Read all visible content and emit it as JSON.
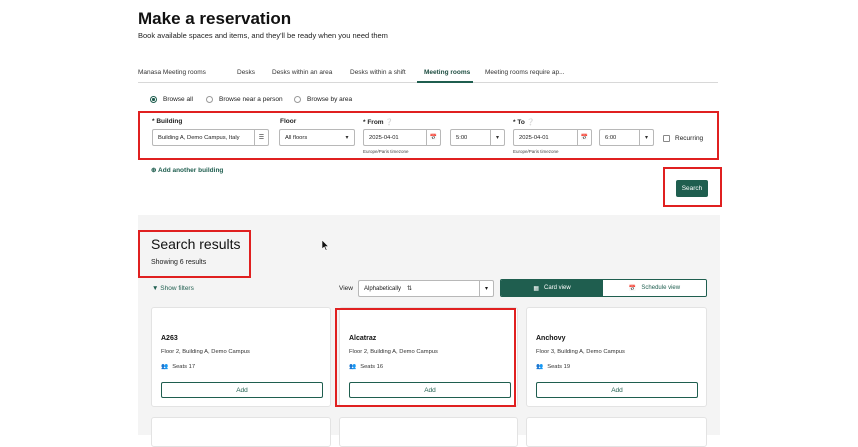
{
  "page": {
    "title": "Make a reservation",
    "subtitle": "Book available spaces and items, and they'll be ready when you need them"
  },
  "tabs": [
    {
      "label": "Manasa Meeting rooms"
    },
    {
      "label": "Desks"
    },
    {
      "label": "Desks within an area"
    },
    {
      "label": "Desks within a shift"
    },
    {
      "label": "Meeting rooms"
    },
    {
      "label": "Meeting rooms require ap..."
    }
  ],
  "active_tab": "Meeting rooms",
  "browse": {
    "options": [
      "Browse all",
      "Browse near a person",
      "Browse by area"
    ],
    "selected": "Browse all"
  },
  "filters": {
    "building_label": "* Building",
    "building_value": "Building A, Demo Campus, Italy",
    "floor_label": "Floor",
    "floor_value": "All floors",
    "from_label": "* From",
    "from_date": "2025-04-01",
    "from_time": "5:00",
    "from_tz": "Europe/Paris timezone",
    "to_label": "* To",
    "to_date": "2025-04-01",
    "to_time": "6:00",
    "to_tz": "Europe/Paris timezone",
    "recurring_label": "Recurring",
    "add_building": "Add another building",
    "search_button": "Search"
  },
  "results": {
    "title": "Search results",
    "count": "Showing 6 results",
    "show_filters": "Show filters",
    "view_label": "View",
    "sort_value": "Alphabetically",
    "card_view": "Card view",
    "schedule_view": "Schedule view",
    "cards": [
      {
        "name": "A263",
        "location": "Floor 2, Building A, Demo Campus",
        "seats": "Seats 17",
        "add": "Add"
      },
      {
        "name": "Alcatraz",
        "location": "Floor 2, Building A, Demo Campus",
        "seats": "Seats 16",
        "add": "Add"
      },
      {
        "name": "Anchovy",
        "location": "Floor 3, Building A, Demo Campus",
        "seats": "Seats 19",
        "add": "Add"
      }
    ]
  },
  "colors": {
    "accent": "#1f5e4f",
    "highlight": "#e02020",
    "panel": "#f4f4f4"
  }
}
